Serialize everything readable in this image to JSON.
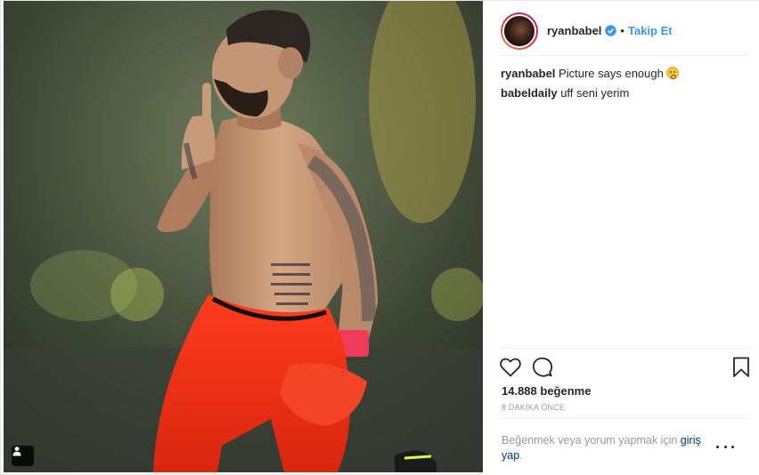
{
  "post": {
    "username": "ryanbabel",
    "verified": true,
    "separator": "•",
    "follow_label": "Takip Et",
    "likes": "14.888 beğenme",
    "timestamp": "8 DAKİKA ÖNCE",
    "comments": [
      {
        "user": "ryanbabel",
        "text": "Picture says enough",
        "emoji": "hushed-face"
      },
      {
        "user": "babeldaily",
        "text": "uff seni yerim"
      }
    ],
    "login_prompt_prefix": "Beğenmek veya yorum yapmak için",
    "login_link": "giriş yap",
    "login_prompt_suffix": "."
  },
  "colors": {
    "link": "#3897f0",
    "text": "#262626",
    "muted": "#999999",
    "login_link": "#003569"
  },
  "icons": [
    "user-tag-icon",
    "heart-icon",
    "comment-icon",
    "bookmark-icon",
    "more-options-icon",
    "verified-badge-icon"
  ]
}
